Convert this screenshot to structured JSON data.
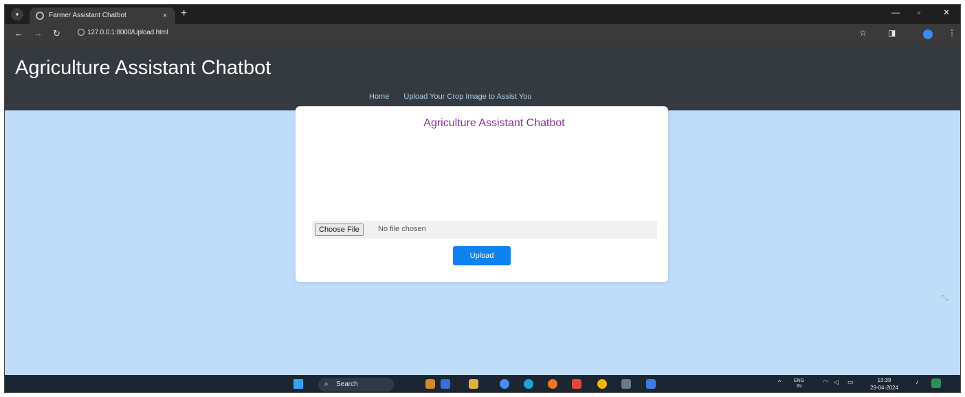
{
  "browser": {
    "tab_title": "Farmer Assistant Chatbot",
    "tab_close": "×",
    "new_tab": "+",
    "url": "127.0.0.1:8000/Upload.html"
  },
  "header": {
    "brand": "Agriculture Assistant Chatbot",
    "nav": [
      {
        "label": "Home"
      },
      {
        "label": "Upload Your Crop Image to Assist You"
      }
    ]
  },
  "card": {
    "title": "Agriculture Assistant Chatbot",
    "file_button": "Choose File",
    "file_status": "No file chosen",
    "upload_button": "Upload"
  },
  "taskbar": {
    "search_placeholder": "Search",
    "language": "ENG",
    "region": "IN",
    "time": "13:39",
    "date": "29-04-2024"
  },
  "colors": {
    "page_bg": "#bfdcf8",
    "header_bg": "#343a40",
    "title_purple": "#8b2f9a",
    "button_blue": "#0d82f0",
    "nav_link": "#a9cfe8"
  }
}
